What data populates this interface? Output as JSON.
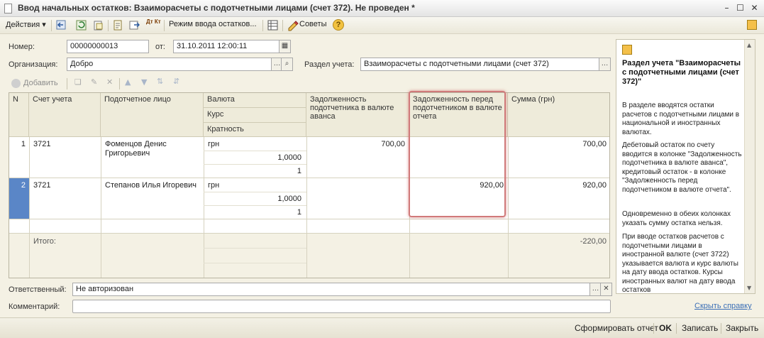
{
  "window": {
    "title": "Ввод начальных остатков: Взаиморасчеты с подотчетными лицами (счет 372). Не проведен *"
  },
  "toolbar": {
    "actions_label": "Действия",
    "mode_label": "Режим ввода остатков...",
    "tips_label": "Советы",
    "dt_kt": "Дт Кт"
  },
  "form": {
    "number_label": "Номер:",
    "number_value": "00000000013",
    "date_label": "от:",
    "date_value": "31.10.2011 12:00:11",
    "org_label": "Организация:",
    "org_value": "Добро",
    "section_label": "Раздел учета:",
    "section_value": "Взаиморасчеты с подотчетными лицами (счет 372)",
    "responsible_label": "Ответственный:",
    "responsible_value": "Не авторизован",
    "comment_label": "Комментарий:",
    "comment_value": ""
  },
  "table_toolbar": {
    "add_label": "Добавить"
  },
  "table": {
    "headers": {
      "n": "N",
      "account": "Счет учета",
      "person": "Подотчетное лицо",
      "currency": "Валюта",
      "rate": "Курс",
      "multiplicity": "Кратность",
      "debt_advance": "Задолженность подотчетника в валюте аванса",
      "debt_report": "Задолженность перед подотчетником в валюте отчета",
      "sum": "Сумма (грн)"
    },
    "rows": [
      {
        "n": "1",
        "account": "3721",
        "person": "Фоменцов Денис Григорьевич",
        "currency": "грн",
        "rate": "1,0000",
        "multiplicity": "1",
        "debt_advance": "700,00",
        "debt_report": "",
        "sum": "700,00"
      },
      {
        "n": "2",
        "account": "3721",
        "person": "Степанов Илья Игоревич",
        "currency": "грн",
        "rate": "1,0000",
        "multiplicity": "1",
        "debt_advance": "",
        "debt_report": "920,00",
        "sum": "920,00"
      }
    ],
    "total_label": "Итого:",
    "total_sum": "-220,00"
  },
  "help": {
    "title": "Раздел учета \"Взаиморасчеты с подотчетными лицами (счет 372)\"",
    "p1": "В разделе вводятся остатки расчетов с подотчетными лицами в национальной и иностранных валютах.",
    "p2": "Дебетовый остаток по счету вводится в колонке \"Задолженность подотчетника в валюте аванса\", кредитовый остаток - в колонке \"Задолженность перед подотчетником в валюте отчета\".",
    "p3": "Одновременно в обеих колонках указать сумму остатка нельзя.",
    "p4": "При вводе остатков расчетов с подотчетными лицами в иностранной валюте (счет 3722) указывается валюта и курс валюты на дату ввода остатков. Курсы иностранных валют на дату ввода остатков",
    "hide_link": "Скрыть справку"
  },
  "bottom": {
    "report_label": "Сформировать отчет",
    "ok_label": "OK",
    "save_label": "Записать",
    "close_label": "Закрыть"
  }
}
